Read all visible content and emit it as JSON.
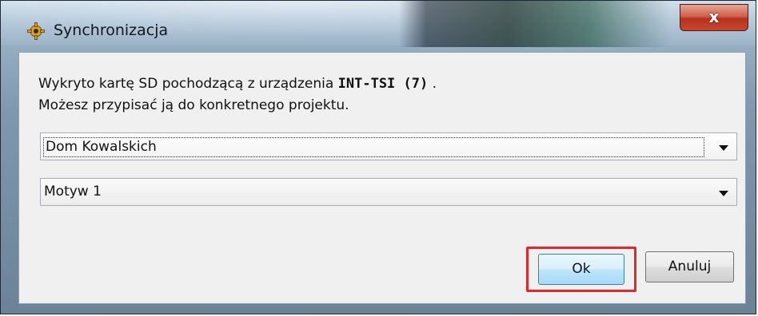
{
  "window": {
    "title": "Synchronizacja",
    "close_label": "x"
  },
  "message": {
    "line1_prefix": "Wykryto kartę SD pochodzącą z urządzenia ",
    "device": "INT-TSI (7)",
    "line1_suffix": " .",
    "line2": "Możesz przypisać ją do konkretnego projektu."
  },
  "project_select": {
    "value": "Dom Kowalskich"
  },
  "theme_select": {
    "value": "Motyw 1"
  },
  "buttons": {
    "ok_label": "Ok",
    "cancel_label": "Anuluj"
  },
  "colors": {
    "highlight": "#e0272c",
    "close_red": "#c8462e"
  },
  "icons": {
    "title": "gear-icon",
    "dropdown": "chevron-down-icon"
  }
}
